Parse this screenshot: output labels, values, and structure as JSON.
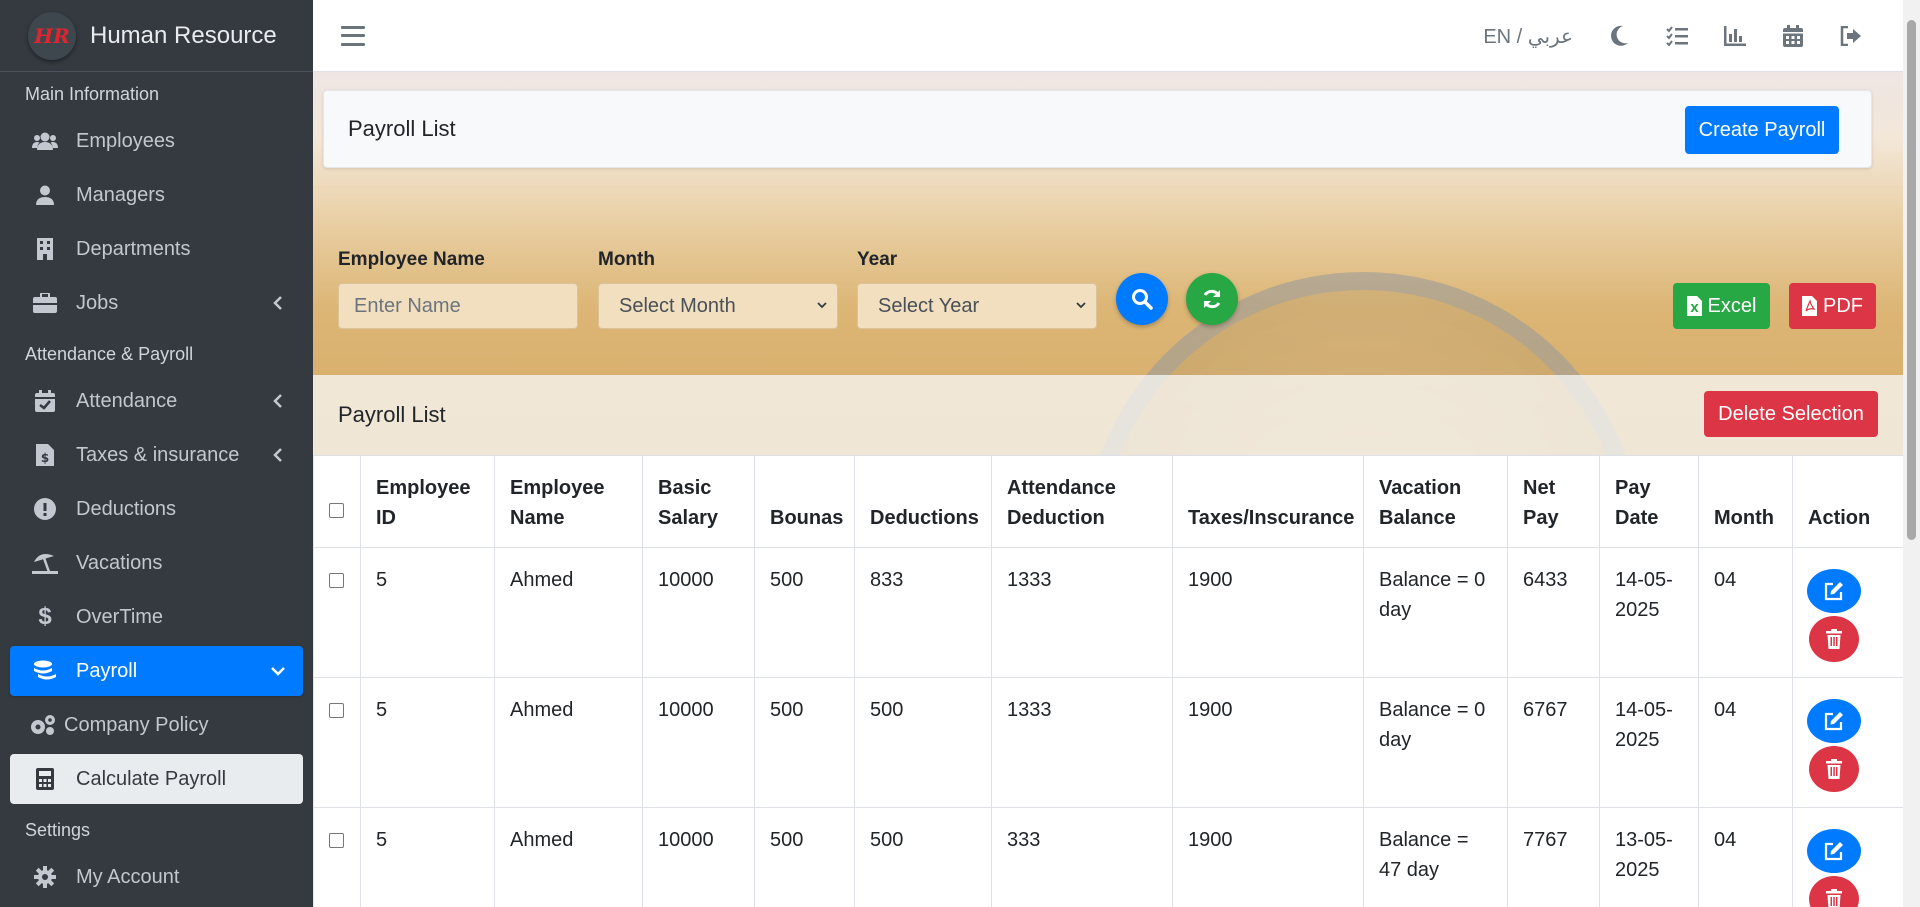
{
  "brand": {
    "logo_text": "HR",
    "name": "Human Resource"
  },
  "sidebar": {
    "sections": [
      {
        "header": "Main Information"
      },
      {
        "header": "Attendance & Payroll"
      },
      {
        "header": "Settings"
      }
    ],
    "items": [
      {
        "label": "Employees",
        "icon": "users-icon"
      },
      {
        "label": "Managers",
        "icon": "user-icon"
      },
      {
        "label": "Departments",
        "icon": "building-icon"
      },
      {
        "label": "Jobs",
        "icon": "briefcase-icon"
      },
      {
        "label": "Attendance",
        "icon": "calendar-check-icon"
      },
      {
        "label": "Taxes & insurance",
        "icon": "file-invoice-dollar-icon"
      },
      {
        "label": "Deductions",
        "icon": "exclamation-circle-icon"
      },
      {
        "label": "Vacations",
        "icon": "umbrella-beach-icon"
      },
      {
        "label": "OverTime",
        "icon": "dollar-icon"
      },
      {
        "label": "Payroll",
        "icon": "coins-icon"
      },
      {
        "label": "Company Policy",
        "icon": "cogs-icon"
      },
      {
        "label": "Calculate Payroll",
        "icon": "calculator-icon"
      },
      {
        "label": "My Account",
        "icon": "gear-icon"
      }
    ]
  },
  "topbar": {
    "lang": "EN / عربي"
  },
  "page": {
    "title": "Payroll List",
    "create_button": "Create Payroll"
  },
  "filters": {
    "employee_name_label": "Employee Name",
    "employee_name_placeholder": "Enter Name",
    "month_label": "Month",
    "month_value": "Select Month",
    "year_label": "Year",
    "year_value": "Select Year",
    "excel_button": "Excel",
    "pdf_button": "PDF"
  },
  "list": {
    "title": "Payroll List",
    "delete_button": "Delete Selection",
    "columns": [
      "Employee ID",
      "Employee Name",
      "Basic Salary",
      "Bounas",
      "Deductions",
      "Attendance Deduction",
      "Taxes/Inscurance",
      "Vacation Balance",
      "Net Pay",
      "Pay Date",
      "Month",
      "Action"
    ],
    "rows": [
      {
        "id": "5",
        "name": "Ahmed",
        "basic": "10000",
        "bonus": "500",
        "deductions": "833",
        "attendance": "1333",
        "taxes": "1900",
        "vacation": "Balance = 0 day",
        "net": "6433",
        "date": "14-05-2025",
        "month": "04"
      },
      {
        "id": "5",
        "name": "Ahmed",
        "basic": "10000",
        "bonus": "500",
        "deductions": "500",
        "attendance": "1333",
        "taxes": "1900",
        "vacation": "Balance = 0 day",
        "net": "6767",
        "date": "14-05-2025",
        "month": "04"
      },
      {
        "id": "5",
        "name": "Ahmed",
        "basic": "10000",
        "bonus": "500",
        "deductions": "500",
        "attendance": "333",
        "taxes": "1900",
        "vacation": "Balance = 47 day",
        "net": "7767",
        "date": "13-05-2025",
        "month": "04"
      }
    ]
  },
  "colors": {
    "sidebar": "#343a40",
    "primary": "#007bff",
    "success": "#28a745",
    "danger": "#dc3545"
  }
}
